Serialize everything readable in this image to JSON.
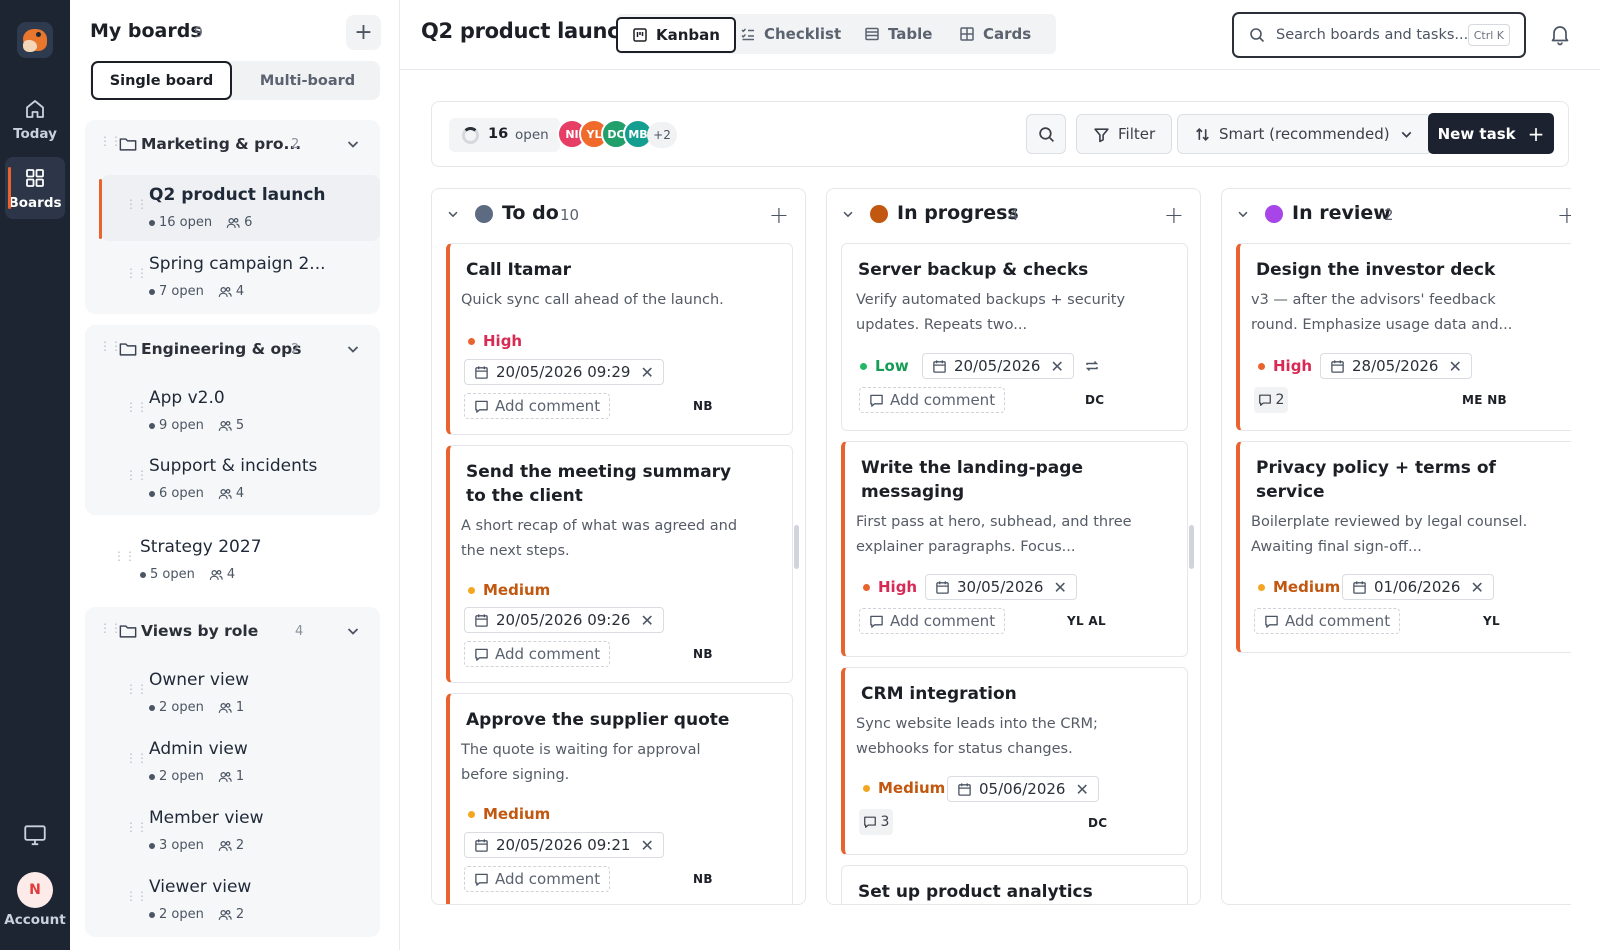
{
  "rail": {
    "today_label": "Today",
    "boards_label": "Boards",
    "account_label": "Account",
    "account_initial": "N"
  },
  "panel": {
    "title": "My boards",
    "count": "9",
    "add_symbol": "+",
    "mode_single": "Single board",
    "mode_multi": "Multi-board",
    "groups": [
      {
        "name": "Marketing & pro...",
        "count": "2",
        "boards": [
          {
            "name": "Q2 product launch",
            "open": "16 open",
            "members": "6"
          },
          {
            "name": "Spring campaign 2...",
            "open": "7 open",
            "members": "4"
          }
        ]
      },
      {
        "name": "Engineering & ops",
        "count": "2",
        "boards": [
          {
            "name": "App v2.0",
            "open": "9 open",
            "members": "5"
          },
          {
            "name": "Support & incidents",
            "open": "6 open",
            "members": "4"
          }
        ]
      },
      {
        "name": "Views by role",
        "count": "4",
        "boards": [
          {
            "name": "Owner view",
            "open": "2 open",
            "members": "1"
          },
          {
            "name": "Admin view",
            "open": "2 open",
            "members": "1"
          },
          {
            "name": "Member view",
            "open": "3 open",
            "members": "2"
          },
          {
            "name": "Viewer view",
            "open": "2 open",
            "members": "2"
          }
        ]
      }
    ],
    "standalone": {
      "name": "Strategy 2027",
      "open": "5 open",
      "members": "4"
    }
  },
  "topbar": {
    "title": "Q2 product launch",
    "views": [
      "Kanban",
      "Checklist",
      "Table",
      "Cards"
    ],
    "search_placeholder": "Search boards and tasks...",
    "search_shortcut": "Ctrl K"
  },
  "toolbar": {
    "open_count": "16",
    "open_label": "open",
    "avatars": [
      {
        "initials": "NI",
        "color": "#e63e64"
      },
      {
        "initials": "YL",
        "color": "#ef6a2b"
      },
      {
        "initials": "DC",
        "color": "#21a06c"
      },
      {
        "initials": "MB",
        "color": "#149e8f"
      }
    ],
    "avatars_more": "+2",
    "filter_label": "Filter",
    "sort_label": "Smart (recommended)",
    "new_task_label": "New task",
    "new_task_symbol": "+"
  },
  "colors": {
    "todo": "#5c6b82",
    "in_progress": "#c2570f",
    "in_review": "#a845e8",
    "high": "#d72a55",
    "medium": "#c2570f",
    "low": "#179b57",
    "accent": "#e8632d"
  },
  "columns": [
    {
      "name": "To do",
      "count": "10",
      "cards": [
        {
          "title": "Call Itamar",
          "desc": "Quick sync call ahead of the launch.",
          "priority": "High",
          "date": "20/05/2026 09:29",
          "comment": "Add comment",
          "assignee": "NB"
        },
        {
          "title": "Send the meeting summary to the client",
          "desc": "A short recap of what was agreed and the next steps.",
          "priority": "Medium",
          "date": "20/05/2026 09:26",
          "comment": "Add comment",
          "assignee": "NB"
        },
        {
          "title": "Approve the supplier quote",
          "desc": "The quote is waiting for approval before signing.",
          "priority": "Medium",
          "date": "20/05/2026 09:21",
          "comment": "Add comment",
          "assignee": "NB"
        }
      ]
    },
    {
      "name": "In progress",
      "count": "4",
      "cards": [
        {
          "title": "Server backup & checks",
          "desc": "Verify automated backups + security updates. Repeats two...",
          "priority": "Low",
          "date": "20/05/2026",
          "comment": "Add comment",
          "assignee": "DC"
        },
        {
          "title": "Write the landing-page messaging",
          "desc": "First pass at hero, subhead, and three explainer paragraphs. Focus...",
          "priority": "High",
          "date": "30/05/2026",
          "comment": "Add comment",
          "assignee": "YL AL"
        },
        {
          "title": "CRM integration",
          "desc": "Sync website leads into the CRM; webhooks for status changes.",
          "priority": "Medium",
          "date": "05/06/2026",
          "comments": "3",
          "assignee": "DC"
        },
        {
          "title": "Set up product analytics"
        }
      ]
    },
    {
      "name": "In review",
      "count": "2",
      "cards": [
        {
          "title": "Design the investor deck",
          "desc": "v3 — after the advisors' feedback round. Emphasize usage data and...",
          "priority": "High",
          "date": "28/05/2026",
          "comments": "2",
          "assignee": "ME NB"
        },
        {
          "title": "Privacy policy + terms of service",
          "desc": "Boilerplate reviewed by legal counsel. Awaiting final sign-off...",
          "priority": "Medium",
          "date": "01/06/2026",
          "comment": "Add comment",
          "assignee": "YL"
        }
      ]
    }
  ]
}
